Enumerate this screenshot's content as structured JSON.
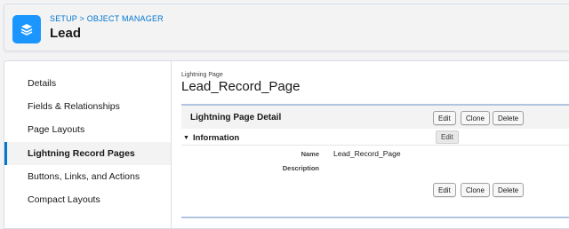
{
  "header": {
    "breadcrumb": "SETUP > OBJECT MANAGER",
    "object_title": "Lead",
    "icon": "layers-icon",
    "icon_color": "#1b96ff"
  },
  "sidebar": {
    "items": [
      {
        "label": "Details",
        "active": false
      },
      {
        "label": "Fields & Relationships",
        "active": false
      },
      {
        "label": "Page Layouts",
        "active": false
      },
      {
        "label": "Lightning Record Pages",
        "active": true
      },
      {
        "label": "Buttons, Links, and Actions",
        "active": false
      },
      {
        "label": "Compact Layouts",
        "active": false
      }
    ],
    "active_color": "#0176d3"
  },
  "main": {
    "page_type": "Lightning Page",
    "page_name": "Lead_Record_Page",
    "detail_title": "Lightning Page Detail",
    "buttons": {
      "edit": "Edit",
      "clone": "Clone",
      "delete": "Delete"
    },
    "tooltip": "Edit",
    "section_title": "Information",
    "fields": [
      {
        "label": "Name",
        "value": "Lead_Record_Page"
      },
      {
        "label": "Description",
        "value": ""
      }
    ]
  }
}
